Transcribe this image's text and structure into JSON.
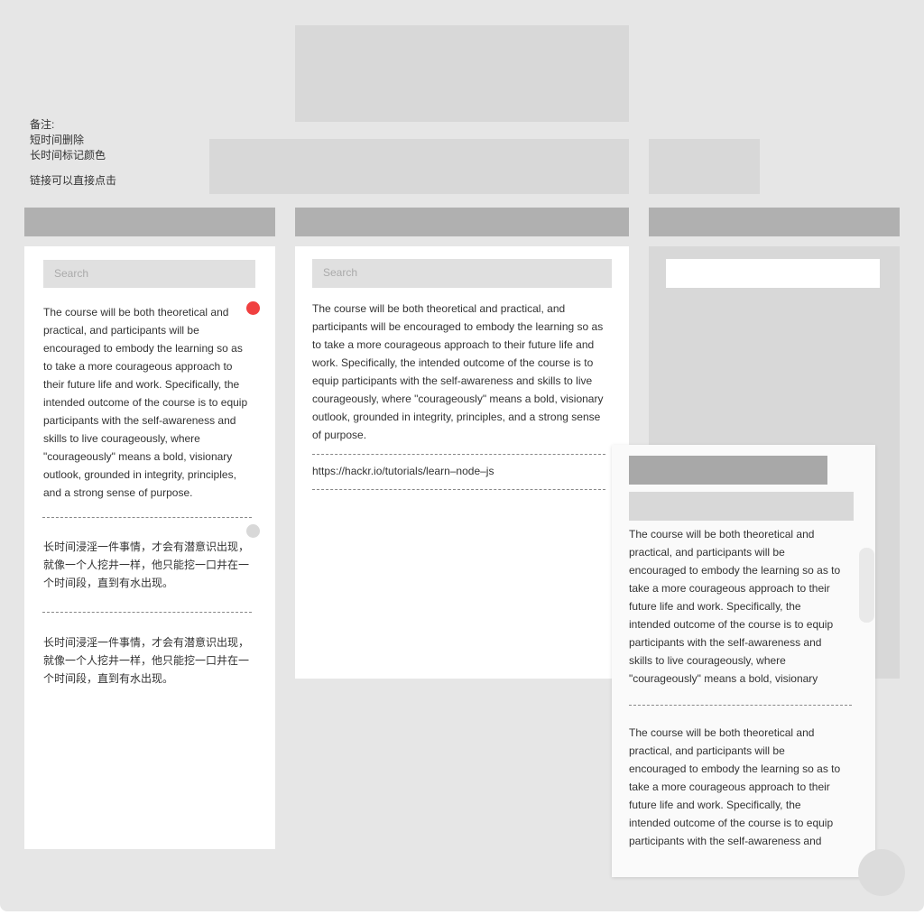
{
  "notes": {
    "title": "备注:",
    "line1": "短时间删除",
    "line2": "长时间标记颜色",
    "line3": "链接可以直接点击"
  },
  "left_panel": {
    "search_placeholder": "Search",
    "card1_text": "The course will be both theoretical and practical, and participants will be encouraged to embody the learning so as to take a more courageous approach to their future life and work. Specifically, the intended outcome of the course is to equip participants with the self-awareness and skills to live courageously, where \"courageously\" means a bold, visionary outlook, grounded in integrity, principles, and a strong sense of purpose.",
    "card1_marker_color": "#f04040",
    "card2_text": "长时间浸淫一件事情，才会有潜意识出现，就像一个人挖井一样，他只能挖一口井在一个时间段，直到有水出现。",
    "card2_marker_color": "#d8d8d8",
    "card3_text": "长时间浸淫一件事情，才会有潜意识出现，就像一个人挖井一样，他只能挖一口井在一个时间段，直到有水出现。"
  },
  "middle_panel": {
    "search_placeholder": "Search",
    "card1_text": "The course will be both theoretical and practical, and participants will be encouraged to embody the learning so as to take a more courageous approach to their future life and work. Specifically, the intended outcome of the course is to equip participants with the self-awareness and skills to live courageously, where \"courageously\" means a bold, visionary outlook, grounded in integrity, principles, and a strong sense of purpose.",
    "link_text": "https://hackr.io/tutorials/learn–node–js"
  },
  "popup": {
    "card1_text": "The course will be both theoretical and practical, and participants will be encouraged to embody the learning so as to take a more courageous approach to their future life and work. Specifically, the intended outcome of the course is to equip participants with the self-awareness and skills to live courageously, where \"courageously\" means a bold, visionary",
    "card2_text": "The course will be both theoretical and practical, and participants will be encouraged to embody the learning so as to take a more courageous approach to their future life and work. Specifically, the intended outcome of the course is to equip participants with the self-awareness and"
  },
  "colors": {
    "canvas": "#e6e6e6",
    "placeholder_light": "#d8d8d8",
    "placeholder_dark": "#b0b0b0",
    "accent_red": "#f04040"
  }
}
